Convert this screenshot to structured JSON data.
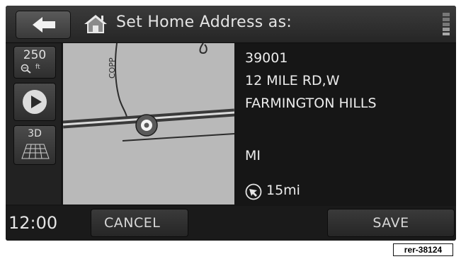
{
  "header": {
    "title": "Set Home Address as:",
    "back_icon": "back-arrow-icon",
    "home_icon": "home-icon",
    "signal_icon": "signal-strength-icon"
  },
  "map_controls": {
    "zoom_value": "250",
    "zoom_unit": "ft",
    "play_icon": "play-icon",
    "view_mode_label": "3D"
  },
  "map": {
    "road_label": "COPP"
  },
  "address": {
    "number": "39001",
    "street": "12 MILE RD,W",
    "city": "FARMINGTON HILLS",
    "state": "MI",
    "distance": "15mi"
  },
  "footer": {
    "time": "12:00",
    "cancel_label": "CANCEL",
    "save_label": "SAVE"
  },
  "reference_code": "rer-38124",
  "colors": {
    "background": "#161616",
    "map": "#b9b9b9",
    "text": "#e4e4e4"
  }
}
